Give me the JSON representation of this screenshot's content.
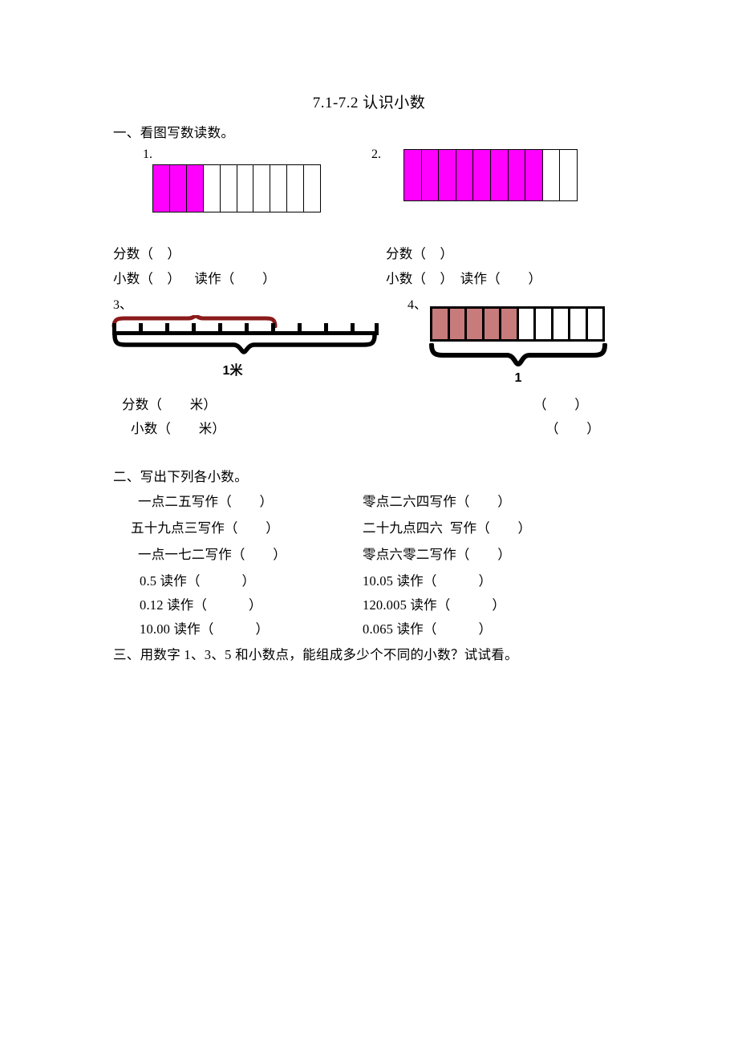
{
  "document": {
    "title": "7.1-7.2 认识小数"
  },
  "section1": {
    "heading": "一、看图写数读数。",
    "items": [
      {
        "number": "1.",
        "figure": {
          "type": "decimal-strip",
          "total_cells": 10,
          "filled_cells": 3,
          "fill_color": "#FF00FF"
        },
        "lines": [
          "分数（    ）",
          "小数（    ）    读作（        ）"
        ]
      },
      {
        "number": "2.",
        "figure": {
          "type": "decimal-strip",
          "total_cells": 10,
          "filled_cells": 8,
          "fill_color": "#FF00FF"
        },
        "lines": [
          "分数（    ）",
          "小数（    ）  读作（        ）"
        ]
      },
      {
        "number": "3、",
        "figure": {
          "type": "ruler",
          "segments": 10,
          "marked_segments": 6,
          "mark_color": "#8B1A1A",
          "brace_label": "1米"
        },
        "lines": [
          "分数（        米）",
          "小数（        米）"
        ]
      },
      {
        "number": "4、",
        "figure": {
          "type": "decimal-strip-thick",
          "total_cells": 10,
          "filled_cells": 5,
          "fill_color": "#C77B7B",
          "brace_label": "1"
        },
        "lines": [
          "（        ）",
          "（        ）"
        ]
      }
    ]
  },
  "section2": {
    "heading": "二、写出下列各小数。",
    "rows": [
      {
        "left": "一点二五写作（        ）",
        "right": "零点二六四写作（        ）"
      },
      {
        "left": "五十九点三写作（        ）",
        "right": "二十九点四六  写作（        ）"
      },
      {
        "left": "一点一七二写作（        ）",
        "right": "零点六零二写作（        ）"
      },
      {
        "left": "0.5 读作（            ）",
        "right": "10.05 读作（            ）"
      },
      {
        "left": "0.12 读作（            ）",
        "right": "120.005 读作（            ）"
      },
      {
        "left": "10.00 读作（            ）",
        "right": "0.065 读作（            ）"
      }
    ]
  },
  "section3": {
    "heading": "三、用数字 1、3、5 和小数点，能组成多少个不同的小数？试试看。"
  }
}
